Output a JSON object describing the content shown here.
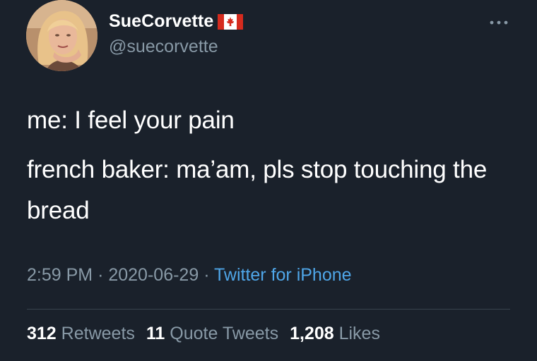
{
  "user": {
    "display_name": "SueCorvette",
    "handle": "@suecorvette",
    "flag_icon": "canada-flag-icon"
  },
  "tweet": {
    "lines": [
      "me: I feel your pain",
      "french baker: ma’am, pls stop touching the bread"
    ],
    "time": "2:59 PM",
    "date": "2020-06-29",
    "separator": "·",
    "source": "Twitter for iPhone"
  },
  "stats": {
    "retweets_count": "312",
    "retweets_label": "Retweets",
    "quotes_count": "11",
    "quotes_label": "Quote Tweets",
    "likes_count": "1,208",
    "likes_label": "Likes"
  },
  "colors": {
    "background": "#1a212b",
    "primary_text": "#ffffff",
    "secondary_text": "#8899a6",
    "link": "#4fa6e8",
    "canada_red": "#d52b1e"
  }
}
